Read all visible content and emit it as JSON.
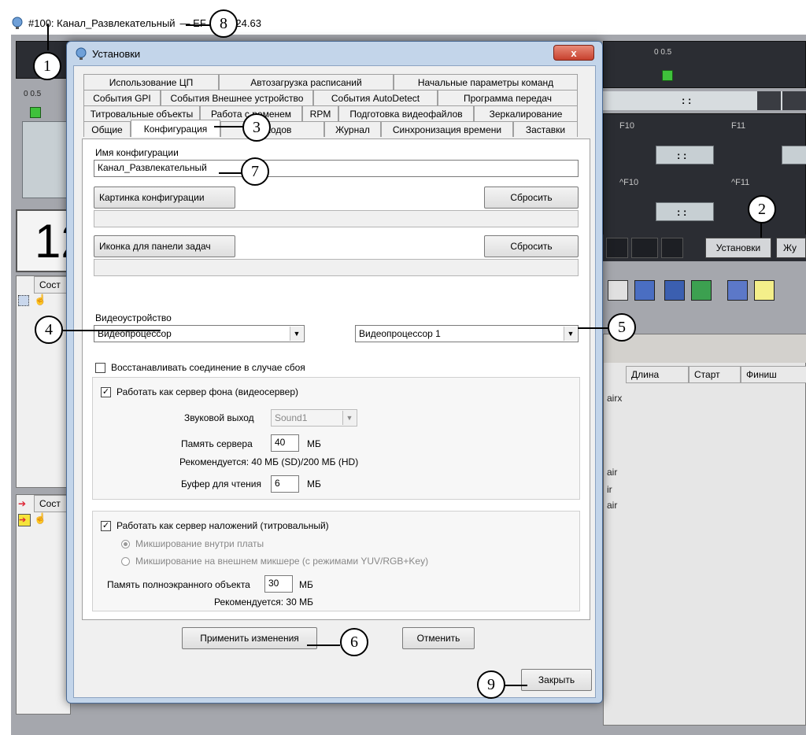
{
  "app": {
    "title": "#100: Канал_Развлекательный",
    "title_suffix": "— EF",
    "title_tail": ".24.63",
    "slider_marks": "0  0.5",
    "fkeys": [
      "F10",
      "F11",
      "^F10",
      "^F11"
    ],
    "time_sep": ":  :",
    "lcd_digit": "12",
    "settings_button": "Установки",
    "journal_button": "Жу",
    "status_header": "Сост",
    "list_headers": [
      "Длина",
      "Старт",
      "Финиш"
    ],
    "list_fragments": [
      "airx",
      "air",
      "ir",
      "air"
    ]
  },
  "dialog": {
    "title": "Установки",
    "close_glyph": "x",
    "tabs": {
      "row1": [
        "Использование ЦП",
        "Автозагрузка расписаний",
        "Начальные параметры команд"
      ],
      "row2": [
        "События GPI",
        "События Внешнее устройство",
        "События AutoDetect",
        "Программа передач"
      ],
      "row3": [
        "Титровальные объекты",
        "Работа с ременем",
        "RPM",
        "Подготовка видеофайлов",
        "Зеркалирование"
      ],
      "row4": [
        "Общие",
        "Конфигурация",
        "   и входов",
        "Журнал",
        "Синхронизация времени",
        "Заставки"
      ]
    },
    "config": {
      "name_label": "Имя конфигурации",
      "name_value": "Канал_Развлекательный",
      "picture_button": "Картинка конфигурации",
      "reset_label": "Сбросить",
      "icon_button": "Иконка для панели задач",
      "video_device_label": "Видеоустройство",
      "video_device_value": "Видеопроцессор",
      "video_processor_value": "Видеопроцессор 1",
      "restore_conn_label": "Восстанавливать соединение в случае сбоя",
      "bg_server_label": "Работать как сервер фона (видеосервер)",
      "sound_out_label": "Звуковой выход",
      "sound_out_value": "Sound1",
      "server_mem_label": "Память сервера",
      "server_mem_value": "40",
      "mb": "МБ",
      "recommend_bg": "Рекомендуется: 40 МБ (SD)/200 МБ (HD)",
      "read_buffer_label": "Буфер для чтения",
      "read_buffer_value": "6",
      "overlay_server_label": "Работать как сервер наложений (титровальный)",
      "mix_internal": "Микширование внутри платы",
      "mix_external": "Микширование на внешнем микшере (с режимами YUV/RGB+Key)",
      "fullscreen_mem_label": "Память полноэкранного объекта",
      "fullscreen_mem_value": "30",
      "recommend_overlay": "Рекомендуется: 30 МБ",
      "apply_button": "Применить изменения",
      "cancel_button": "Отменить",
      "close_button": "Закрыть"
    }
  },
  "callouts": [
    "1",
    "2",
    "3",
    "4",
    "5",
    "6",
    "7",
    "8",
    "9"
  ]
}
